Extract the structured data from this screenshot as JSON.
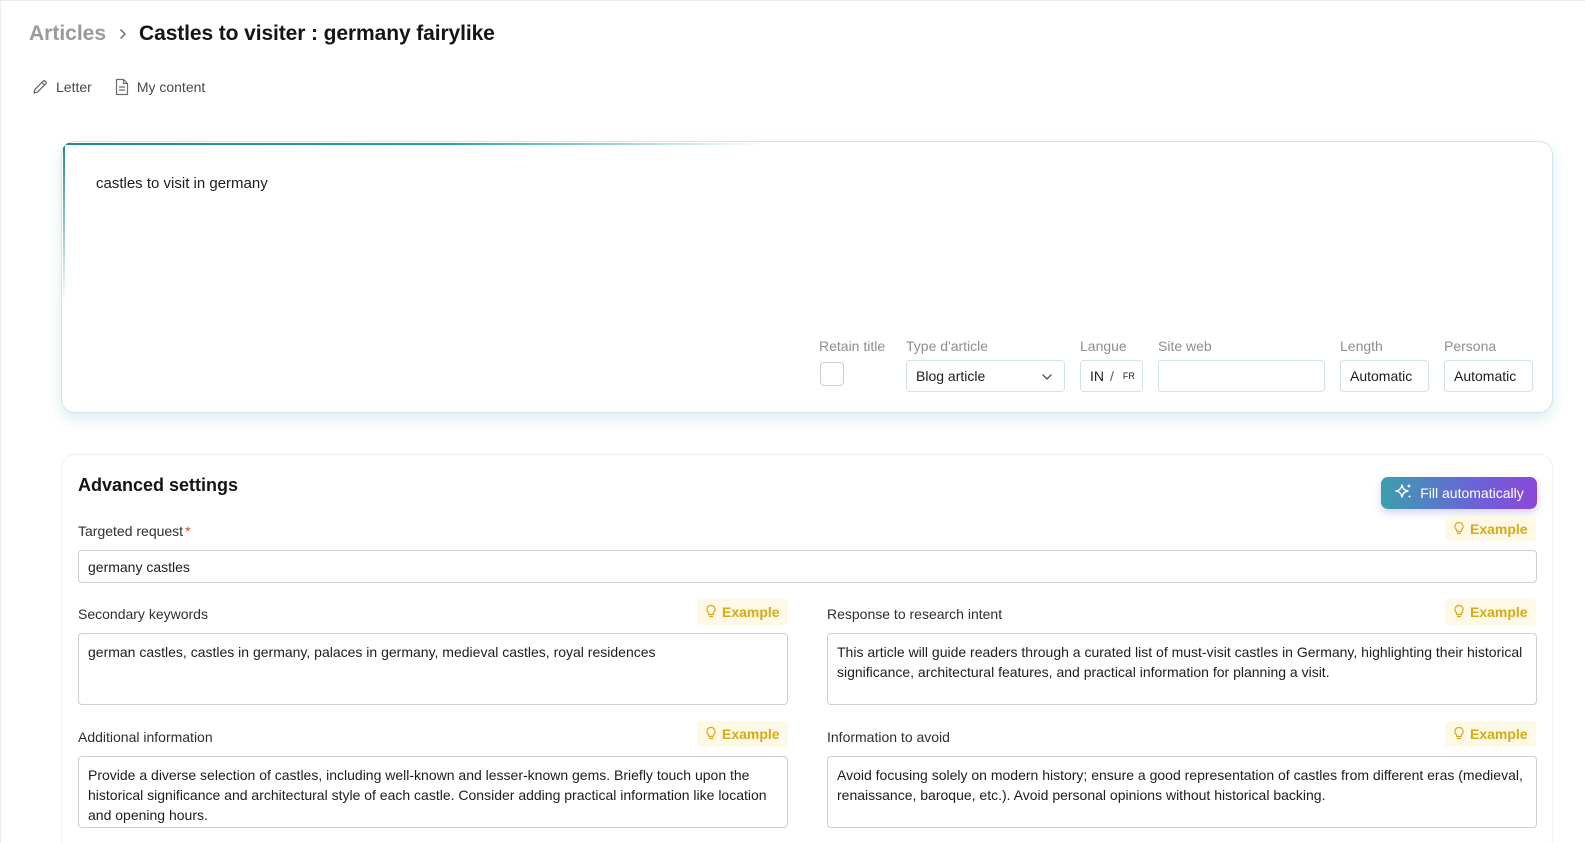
{
  "breadcrumb": {
    "root": "Articles",
    "current": "Castles to visiter : germany fairylike"
  },
  "toolbar": {
    "letter": {
      "label": "Letter",
      "icon": "pencil-icon"
    },
    "my_content": {
      "label": "My content",
      "icon": "document-icon"
    }
  },
  "prompt": {
    "text": "castles to visit in germany"
  },
  "fields": {
    "retain_title": {
      "label": "Retain title",
      "checked": false
    },
    "article_type": {
      "label": "Type d'article",
      "value": "Blog article"
    },
    "language": {
      "label": "Langue",
      "active": "IN",
      "separator": "/",
      "other": "FR"
    },
    "website": {
      "label": "Site web",
      "value": ""
    },
    "length": {
      "label": "Length",
      "value": "Automatic"
    },
    "persona": {
      "label": "Persona",
      "value": "Automatic"
    }
  },
  "advanced": {
    "title": "Advanced settings",
    "fill_button": "Fill automatically",
    "example_label": "Example",
    "targeted_request": {
      "label": "Targeted request",
      "required_mark": "*",
      "value": "germany castles"
    },
    "secondary_keywords": {
      "label": "Secondary keywords",
      "value": "german castles, castles in germany, palaces in germany, medieval castles, royal residences"
    },
    "research_intent": {
      "label": "Response to research intent",
      "value": "This article will guide readers through a curated list of must-visit castles in Germany, highlighting their historical significance, architectural features, and practical information for planning a visit."
    },
    "additional_info": {
      "label": "Additional information",
      "value": "Provide a diverse selection of castles, including well-known and lesser-known gems. Briefly touch upon the historical significance and architectural style of each castle. Consider adding practical information like location and opening hours."
    },
    "info_to_avoid": {
      "label": "Information to avoid",
      "value": "Avoid focusing solely on modern history; ensure a good representation of castles from different eras (medieval, renaissance, baroque, etc.). Avoid personal opinions without historical backing."
    }
  },
  "colors": {
    "accent_teal": "#1f8a8f",
    "accent_purple": "#8a48d9",
    "example_yellow": "#d8a915",
    "required_red": "#d9453b"
  }
}
